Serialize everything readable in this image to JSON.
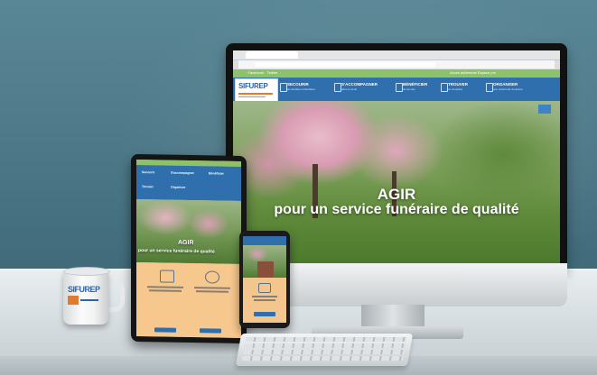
{
  "monitor": {
    "strip": {
      "left": "· Facebook · Twitter",
      "right": "Accès adhérents   Espace pro"
    },
    "logo": "SIFUREP",
    "nav": [
      {
        "label": "SECOURIR",
        "sub": "les familles endeuillées"
      },
      {
        "label": "S'ACCOMPAGNER",
        "sub": "dans le deuil"
      },
      {
        "label": "BÉNÉFICIER",
        "sub": "du service"
      },
      {
        "label": "TROUVER",
        "sub": "un cimetière"
      },
      {
        "label": "ORGANISER",
        "sub": "une cérémonie funéraire"
      }
    ],
    "hero_title_1": "AGIR",
    "hero_title_2": "pour un service funéraire de qualité"
  },
  "tablet": {
    "nav": [
      "Secourir",
      "S'accompagner",
      "Bénéficier",
      "Trouver",
      "Organiser"
    ],
    "hero_title_1": "AGIR",
    "hero_title_2": "pour un service funéraire de qualité"
  },
  "mug": {
    "logo": "SIFUREP"
  },
  "colors": {
    "background": "#4b7685",
    "brand_blue": "#2f6fae",
    "brand_green": "#8cc36a",
    "brand_orange": "#e07a2e",
    "peach": "#f6c88e"
  },
  "icons": [
    "monitor",
    "tablet",
    "phone",
    "mug",
    "keyboard"
  ]
}
